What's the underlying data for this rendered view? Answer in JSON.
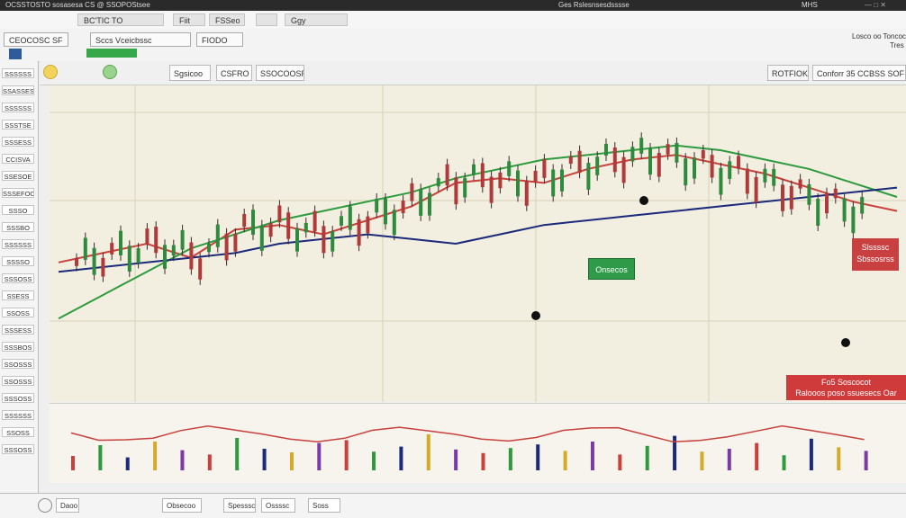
{
  "titlebar": {
    "left_text": "OCSSTOSTO sosasesa CS @ SSOPOStsee",
    "center_text": "Ges Rslesnsesdsssse",
    "right_text": "MHS"
  },
  "menubar": {
    "tabs": [
      "BC'TIC TO",
      "Fiit",
      "FSSeo",
      "",
      "Ggy"
    ]
  },
  "toolbar": {
    "symbol_field": "CEOCOSC SF",
    "search_field": "Sccs Vceicbssc",
    "interval_field": "FIODO",
    "right_label_1": "Losco oo Toncoc",
    "right_label_2": "Tres"
  },
  "subbar": {
    "tools": [
      "Sgsicoo",
      "CSFRO",
      "SSOCOOSRO"
    ],
    "right_btn_1": "ROTFIOK",
    "right_btn_2": "Conforr 35 ССВSS SOF Э8"
  },
  "sidebar": {
    "items": [
      "SSSSSS",
      "SSASSES",
      "SSSSSS",
      "SSSTSE",
      "SSSESS",
      "CCISVA",
      "SSESOE",
      "SSSEFOO",
      "SSSO",
      "SSSBO",
      "SSSSSS",
      "SSSSO",
      "SSSOSS",
      "SSESS",
      "SSOSS",
      "SSSESS",
      "SSSBOS",
      "SSOSSS",
      "SSOSSS",
      "SSSOSS",
      "SSSSSS",
      "SSOSS",
      "SSSOSS"
    ]
  },
  "callouts": {
    "green_label": "Onsecos",
    "red_label_1": "Slssssc",
    "red_label_2": "Sbssosrss",
    "bottom_red_line1": "Fo5 Soscocot",
    "bottom_red_line2": "Ralooos poso ssuesecs Oar"
  },
  "statusbar": {
    "btn_1": "Obsecoo",
    "btn_2": "Spesssco",
    "btn_3": "Ossssc",
    "time_left": "Daoo",
    "time_right": "Soss"
  },
  "chart_data": {
    "type": "line",
    "x": [
      "1",
      "2",
      "3",
      "4",
      "5",
      "6",
      "7",
      "8",
      "9",
      "10",
      "11",
      "12",
      "13",
      "14",
      "15",
      "16",
      "17",
      "18",
      "19",
      "20"
    ],
    "series": [
      {
        "values": [
          86,
          88,
          90,
          87,
          93,
          94,
          92,
          95,
          98,
          103,
          104,
          103,
          106,
          108,
          109,
          107,
          105,
          102,
          99,
          97
        ]
      },
      {
        "values": [
          74,
          79,
          84,
          89,
          92,
          95,
          97,
          99,
          101,
          104,
          106,
          108,
          109,
          110,
          111,
          110,
          108,
          106,
          103,
          100
        ]
      },
      {
        "values": [
          84,
          85,
          86,
          87,
          88,
          90,
          91,
          92,
          91,
          90,
          92,
          94,
          95,
          96,
          97,
          98,
          99,
          100,
          101,
          102
        ]
      }
    ],
    "volume": [
      20,
      35,
      18,
      40,
      28,
      22,
      45,
      30,
      25,
      38,
      42,
      26,
      33,
      50,
      29,
      24,
      31,
      36,
      27,
      40,
      22,
      34,
      48,
      26,
      30,
      38,
      21,
      44,
      32,
      27
    ],
    "colors": {
      "green": "#2e9a3e",
      "red": "#c8413c",
      "navy": "#1b2a7a",
      "blue": "#2c5fb3"
    }
  }
}
